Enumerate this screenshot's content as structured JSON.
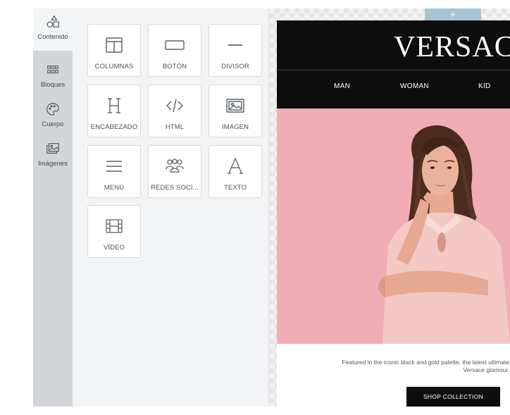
{
  "sidebar": {
    "items": [
      {
        "label": "Contenido",
        "icon": "content-shapes-icon",
        "active": true
      },
      {
        "label": "Bloques",
        "icon": "blocks-grid-icon",
        "active": false
      },
      {
        "label": "Cuerpo",
        "icon": "palette-icon",
        "active": false
      },
      {
        "label": "Imágenes",
        "icon": "images-icon",
        "active": false
      }
    ]
  },
  "tools": [
    {
      "label": "COLUMNAS",
      "icon": "columns-icon"
    },
    {
      "label": "BOTÓN",
      "icon": "button-icon"
    },
    {
      "label": "DIVISOR",
      "icon": "divider-icon"
    },
    {
      "label": "ENCABEZADO",
      "icon": "heading-icon"
    },
    {
      "label": "HTML",
      "icon": "html-code-icon"
    },
    {
      "label": "IMAGEN",
      "icon": "image-icon"
    },
    {
      "label": "MENÚ",
      "icon": "menu-icon"
    },
    {
      "label": "REDES SOCI...",
      "icon": "social-icon"
    },
    {
      "label": "TEXTO",
      "icon": "text-icon"
    },
    {
      "label": "VÍDEO",
      "icon": "video-icon"
    }
  ],
  "canvas": {
    "add_label": "+",
    "email": {
      "brand": "VERSACE",
      "nav": [
        "MAN",
        "WOMAN",
        "KID"
      ],
      "copy": "Featured in the iconic black and gold palette, the latest ultimate Versace glamour.",
      "cta": "SHOP COLLECTION"
    }
  },
  "colors": {
    "rail_bg": "#d2d6da",
    "panel_bg": "#f3f4f6",
    "email_black": "#0d0d0d",
    "hero_pink": "#f0aeb4",
    "add_tab": "#a7c6d4"
  }
}
